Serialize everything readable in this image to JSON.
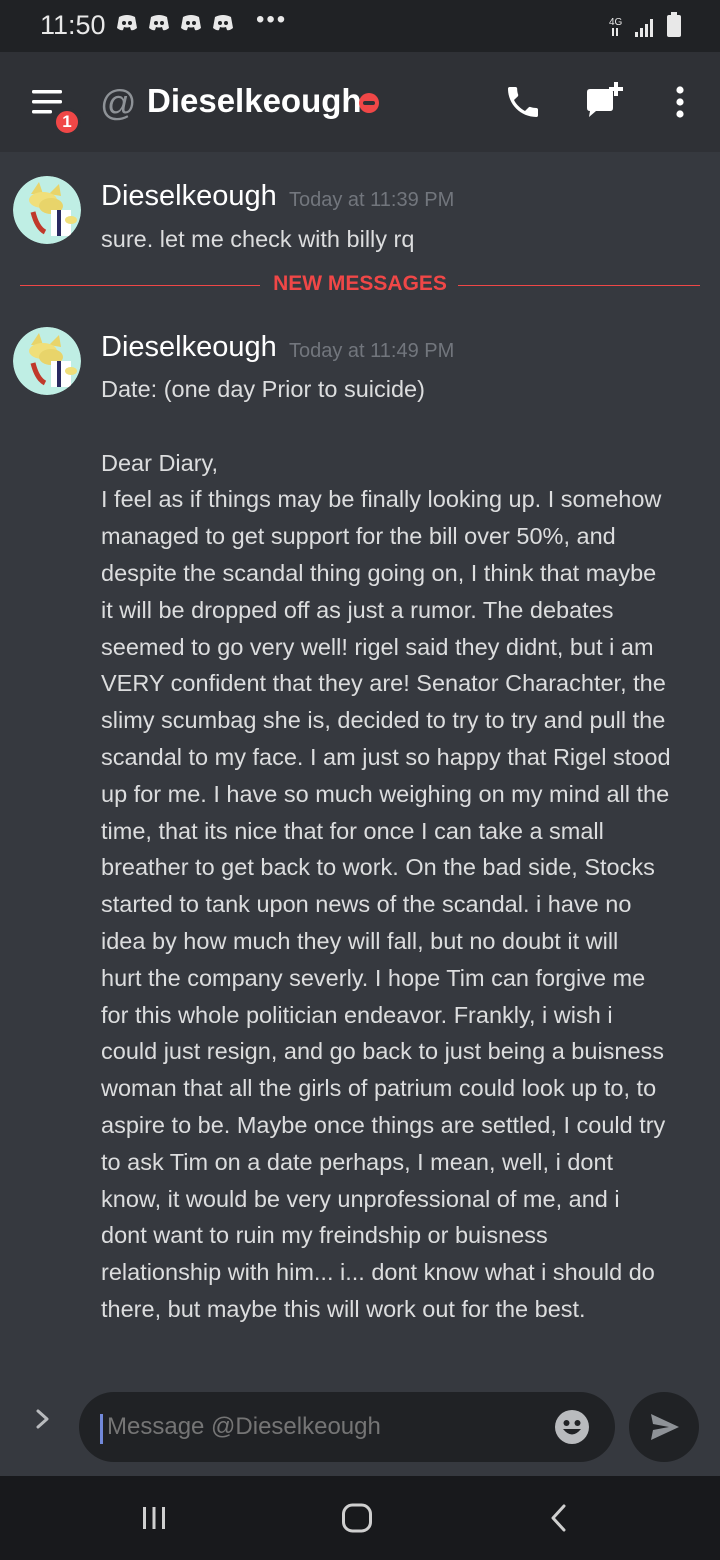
{
  "status_bar": {
    "time": "11:50",
    "overflow": "•••",
    "notification_icons": [
      "discord-icon",
      "discord-icon",
      "discord-icon",
      "discord-icon"
    ],
    "system_icons": [
      "wifi-icon",
      "signal-icon",
      "battery-icon"
    ]
  },
  "header": {
    "badge_count": "1",
    "at_symbol": "@",
    "title": "Dieselkeough",
    "status": "do-not-disturb",
    "buttons": [
      "phone-icon",
      "add-dm-icon",
      "more-vertical-icon"
    ]
  },
  "messages": [
    {
      "author": "Dieselkeough",
      "timestamp": "Today at 11:39 PM",
      "lines": [
        "sure. let me check with billy rq"
      ]
    },
    {
      "author": "Dieselkeough",
      "timestamp": "Today at 11:49 PM",
      "lines": [
        "Date: (one day Prior to suicide)",
        "",
        "Dear Diary,",
        "I feel as if things may be finally looking up. I somehow",
        "managed to get support for the bill over 50%, and",
        "despite the scandal thing going on, I think that maybe",
        "it will be dropped off as just a rumor. The debates",
        "seemed to go very well! rigel said they didnt, but i am",
        "VERY confident that they are! Senator Charachter, the",
        "slimy scumbag she is, decided to try to try and pull the",
        "scandal to my face. I am just so happy that Rigel stood",
        "up for me. I have so much weighing on my mind all the",
        "time, that its nice that for once I can take a small",
        "breather to get back to work. On the bad side, Stocks",
        "started to tank upon news of the scandal. i have no",
        "idea by how much they will fall, but no doubt it will",
        "hurt the company severly. I hope Tim can forgive me",
        "for this whole politician endeavor. Frankly, i wish i",
        "could just resign, and go back to just being a buisness",
        "woman that all the girls of patrium could look up to, to",
        "aspire to be. Maybe once things are settled, I could try",
        "to ask Tim on a date perhaps, I mean, well, i dont",
        "know, it would be very unprofessional of me, and i",
        "dont want to ruin my freindship or buisness",
        "relationship with him... i... dont know what i should do",
        "there, but maybe this will work out for the best."
      ]
    }
  ],
  "divider": {
    "label": "NEW MESSAGES"
  },
  "composer": {
    "placeholder": "Message @Dieselkeough"
  },
  "navbar": {
    "buttons": [
      "recent-apps-icon",
      "home-icon",
      "back-icon"
    ]
  },
  "colors": {
    "background": "#36393f",
    "header": "#2f3136",
    "input": "#202225",
    "accent_red": "#f04747",
    "blurple": "#7289da",
    "timestamp": "#72767d"
  }
}
